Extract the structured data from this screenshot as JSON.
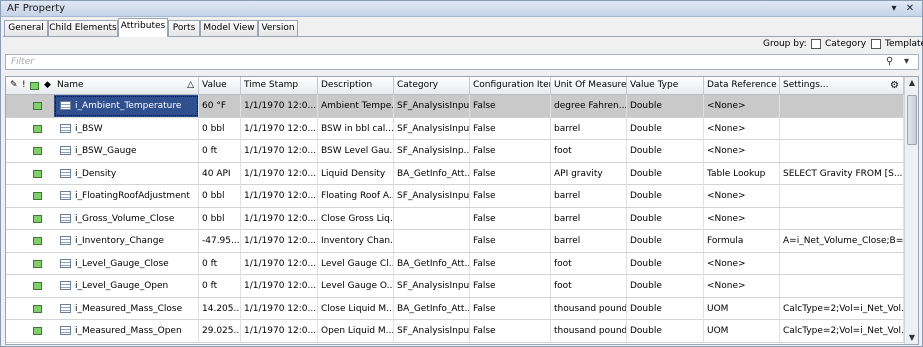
{
  "window": {
    "title": "AF Property",
    "pin_icon": "pin-icon",
    "close_icon": "close-icon"
  },
  "tabs": [
    {
      "label": "General"
    },
    {
      "label": "Child Elements"
    },
    {
      "label": "Attributes"
    },
    {
      "label": "Ports"
    },
    {
      "label": "Model View"
    },
    {
      "label": "Version"
    }
  ],
  "groupby": {
    "label": "Group by:",
    "category": "Category",
    "template": "Template"
  },
  "filter": {
    "placeholder": "Filter"
  },
  "grid": {
    "columns": [
      "Name",
      "Value",
      "Time Stamp",
      "Description",
      "Category",
      "Configuration Item",
      "Unit Of Measure",
      "Value Type",
      "Data Reference",
      "Settings..."
    ],
    "rows": [
      {
        "name": "i_Ambient_Temperature",
        "value": "60 °F",
        "timestamp": "1/1/1970 12:0...",
        "description": "Ambient Tempe...",
        "category": "SF_AnalysisInput",
        "config": "False",
        "uom": "degree Fahren...",
        "type": "Double",
        "dataref": "<None>",
        "settings": ""
      },
      {
        "name": "i_BSW",
        "value": "0 bbl",
        "timestamp": "1/1/1970 12:0...",
        "description": "BSW in bbl cal...",
        "category": "SF_AnalysisInput",
        "config": "False",
        "uom": "barrel",
        "type": "Double",
        "dataref": "<None>",
        "settings": ""
      },
      {
        "name": "i_BSW_Gauge",
        "value": "0 ft",
        "timestamp": "1/1/1970 12:0...",
        "description": "BSW Level Gau...",
        "category": "SF_AnalysisInp...",
        "config": "False",
        "uom": "foot",
        "type": "Double",
        "dataref": "<None>",
        "settings": ""
      },
      {
        "name": "i_Density",
        "value": "40 API",
        "timestamp": "1/1/1970 12:0...",
        "description": "Liquid Density",
        "category": "BA_GetInfo_Att...",
        "config": "False",
        "uom": "API gravity",
        "type": "Double",
        "dataref": "Table Lookup",
        "settings": "SELECT Gravity FROM [S..."
      },
      {
        "name": "i_FloatingRoofAdjustment",
        "value": "0 bbl",
        "timestamp": "1/1/1970 12:0...",
        "description": "Floating Roof A...",
        "category": "SF_AnalysisInput",
        "config": "False",
        "uom": "barrel",
        "type": "Double",
        "dataref": "<None>",
        "settings": ""
      },
      {
        "name": "i_Gross_Volume_Close",
        "value": "0 bbl",
        "timestamp": "1/1/1970 12:0...",
        "description": "Close Gross Liq...",
        "category": "",
        "config": "False",
        "uom": "barrel",
        "type": "Double",
        "dataref": "<None>",
        "settings": ""
      },
      {
        "name": "i_Inventory_Change",
        "value": "-47.95...",
        "timestamp": "1/1/1970 12:0...",
        "description": "Inventory Chan...",
        "category": "",
        "config": "False",
        "uom": "barrel",
        "type": "Double",
        "dataref": "Formula",
        "settings": "A=i_Net_Volume_Close;B=..."
      },
      {
        "name": "i_Level_Gauge_Close",
        "value": "0 ft",
        "timestamp": "1/1/1970 12:0...",
        "description": "Level Gauge Cl...",
        "category": "BA_GetInfo_Att...",
        "config": "False",
        "uom": "foot",
        "type": "Double",
        "dataref": "<None>",
        "settings": ""
      },
      {
        "name": "i_Level_Gauge_Open",
        "value": "0 ft",
        "timestamp": "1/1/1970 12:0...",
        "description": "Level Gauge O...",
        "category": "SF_AnalysisInput",
        "config": "False",
        "uom": "foot",
        "type": "Double",
        "dataref": "<None>",
        "settings": ""
      },
      {
        "name": "i_Measured_Mass_Close",
        "value": "14.205...",
        "timestamp": "1/1/1970 12:0...",
        "description": "Close Liquid M...",
        "category": "BA_GetInfo_Att...",
        "config": "False",
        "uom": "thousand pound",
        "type": "Double",
        "dataref": "UOM",
        "settings": "CalcType=2;Vol=i_Net_Vol..."
      },
      {
        "name": "i_Measured_Mass_Open",
        "value": "29.025...",
        "timestamp": "1/1/1970 12:0...",
        "description": "Open Liquid M...",
        "category": "SF_AnalysisInput",
        "config": "False",
        "uom": "thousand pound",
        "type": "Double",
        "dataref": "UOM",
        "settings": "CalcType=2;Vol=i_Net_Vol..."
      }
    ]
  },
  "icons": {
    "header_left": [
      "pencil-icon",
      "exclamation-icon",
      "green-square-icon",
      "diamond-icon"
    ],
    "settings_gear": "gear-icon",
    "search": "search-icon",
    "dropdown": "chevron-down-icon"
  },
  "colors": {
    "selection": "#2f4f8f",
    "selected_row": "#c9c9c9",
    "attribute_green": "#7fcf6a"
  }
}
